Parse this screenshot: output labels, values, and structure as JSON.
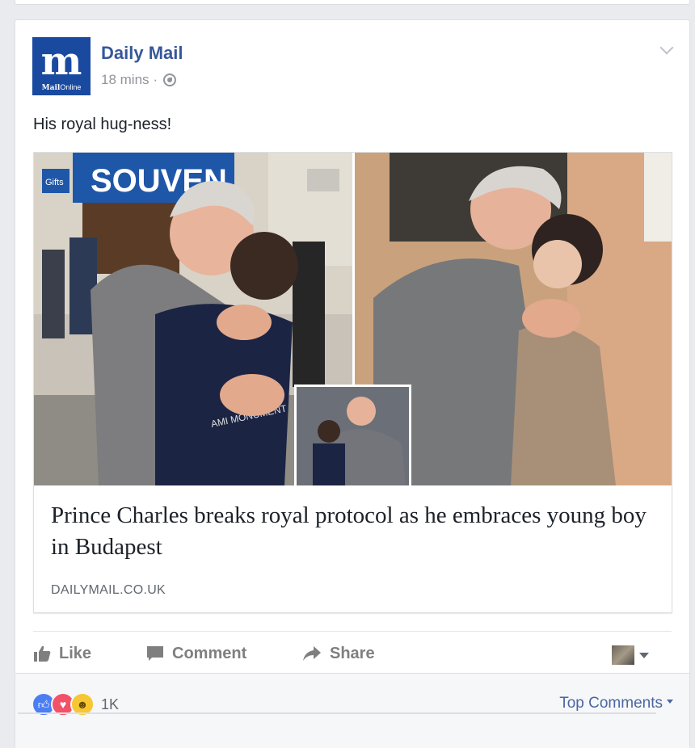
{
  "post": {
    "page_name": "Daily Mail",
    "time": "18 mins",
    "separator": "·",
    "privacy_icon": "globe-icon",
    "text": "His royal hug-ness!"
  },
  "logo": {
    "mark": "m",
    "brand_bold": "Mail",
    "brand_light": "Online",
    "color": "#1a4aa0"
  },
  "link_preview": {
    "headline": "Prince Charles breaks royal protocol as he embraces young boy in Budapest",
    "domain": "DAILYMAIL.CO.UK",
    "image_sign_text": "SOUVEN",
    "image_small_sign": "Gifts",
    "image_shirt_text": "AMI MONUMENT"
  },
  "actions": {
    "like": "Like",
    "comment": "Comment",
    "share": "Share"
  },
  "reactions": {
    "icons": [
      "like-reaction-icon",
      "love-reaction-icon",
      "haha-reaction-icon"
    ],
    "count": "1K"
  },
  "comments_sort": "Top Comments",
  "colors": {
    "link_blue": "#365899",
    "muted": "#90949c",
    "action_gray": "#7f7f7f",
    "like_blue": "#4b7ef3",
    "love_red": "#f25268",
    "haha_yellow": "#f7c733"
  }
}
